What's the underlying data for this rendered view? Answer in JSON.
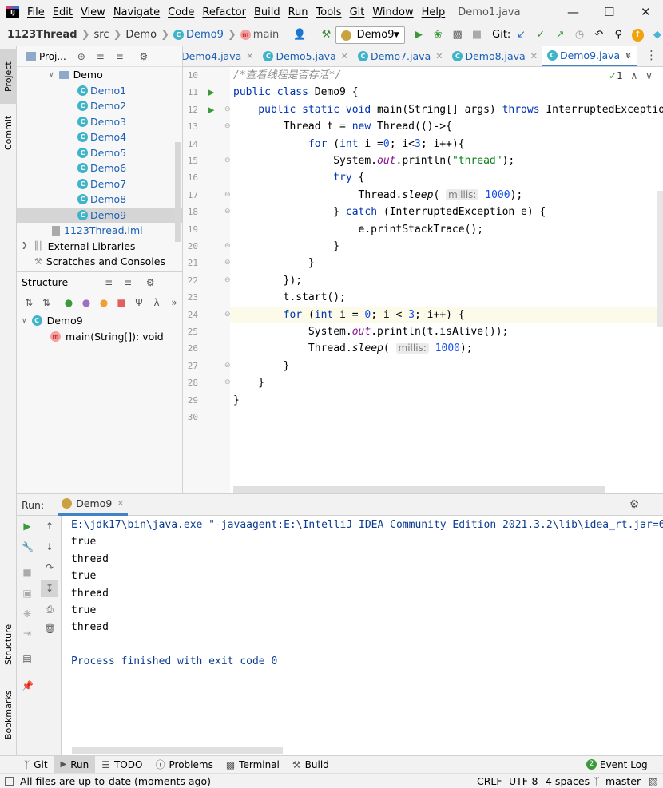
{
  "menubar": {
    "items": [
      "File",
      "Edit",
      "View",
      "Navigate",
      "Code",
      "Refactor",
      "Build",
      "Run",
      "Tools",
      "Git",
      "Window",
      "Help"
    ],
    "window_title": "Demo1.java"
  },
  "navbar": {
    "breadcrumbs": [
      "1123Thread",
      "src",
      "Demo",
      "Demo9",
      "main"
    ],
    "run_config": "Demo9",
    "git_label": "Git:"
  },
  "left_stripe": {
    "project": "Project",
    "commit": "Commit",
    "structure": "Structure",
    "bookmarks": "Bookmarks"
  },
  "project_panel": {
    "title": "Proj...",
    "tree": [
      {
        "label": "Demo",
        "type": "folder",
        "indent": 1
      },
      {
        "label": "Demo1",
        "type": "class",
        "indent": 2
      },
      {
        "label": "Demo2",
        "type": "class",
        "indent": 2
      },
      {
        "label": "Demo3",
        "type": "class",
        "indent": 2
      },
      {
        "label": "Demo4",
        "type": "class",
        "indent": 2
      },
      {
        "label": "Demo5",
        "type": "class",
        "indent": 2
      },
      {
        "label": "Demo6",
        "type": "class",
        "indent": 2
      },
      {
        "label": "Demo7",
        "type": "class",
        "indent": 2
      },
      {
        "label": "Demo8",
        "type": "class",
        "indent": 2
      },
      {
        "label": "Demo9",
        "type": "class",
        "indent": 2,
        "selected": true
      },
      {
        "label": "1123Thread.iml",
        "type": "iml",
        "indent": 1
      },
      {
        "label": "External Libraries",
        "type": "lib",
        "indent": 0
      },
      {
        "label": "Scratches and Consoles",
        "type": "scratch",
        "indent": 0
      }
    ]
  },
  "structure_panel": {
    "title": "Structure",
    "class_name": "Demo9",
    "member": "main(String[]): void"
  },
  "editor": {
    "tabs": [
      {
        "label": "Demo4.java",
        "active": false
      },
      {
        "label": "Demo5.java",
        "active": false
      },
      {
        "label": "Demo7.java",
        "active": false
      },
      {
        "label": "Demo8.java",
        "active": false
      },
      {
        "label": "Demo9.java",
        "active": true
      }
    ],
    "inspection_count": "1",
    "line_numbers": [
      "10",
      "11",
      "12",
      "13",
      "14",
      "15",
      "16",
      "17",
      "18",
      "19",
      "20",
      "21",
      "22",
      "23",
      "24",
      "25",
      "26",
      "27",
      "28",
      "29",
      "30"
    ],
    "lines": [
      [
        {
          "t": "/*查看线程是否存活*/",
          "c": "cm"
        }
      ],
      [
        {
          "t": "public class ",
          "c": "kw"
        },
        {
          "t": "Demo9 {",
          "c": ""
        }
      ],
      [
        {
          "t": "    public static void ",
          "c": "kw"
        },
        {
          "t": "main",
          "c": ""
        },
        {
          "t": "(String[] args) ",
          "c": ""
        },
        {
          "t": "throws ",
          "c": "kw"
        },
        {
          "t": "InterruptedException {",
          "c": ""
        }
      ],
      [
        {
          "t": "        Thread t = ",
          "c": ""
        },
        {
          "t": "new ",
          "c": "kw"
        },
        {
          "t": "Thread(()->{",
          "c": ""
        }
      ],
      [
        {
          "t": "            ",
          "c": ""
        },
        {
          "t": "for ",
          "c": "kw"
        },
        {
          "t": "(",
          "c": ""
        },
        {
          "t": "int ",
          "c": "kw"
        },
        {
          "t": "i =",
          "c": ""
        },
        {
          "t": "0",
          "c": "num"
        },
        {
          "t": "; i<",
          "c": ""
        },
        {
          "t": "3",
          "c": "num"
        },
        {
          "t": "; i++){",
          "c": ""
        }
      ],
      [
        {
          "t": "                System.",
          "c": ""
        },
        {
          "t": "out",
          "c": "it"
        },
        {
          "t": ".println(",
          "c": ""
        },
        {
          "t": "\"thread\"",
          "c": "str"
        },
        {
          "t": ");",
          "c": ""
        }
      ],
      [
        {
          "t": "                ",
          "c": ""
        },
        {
          "t": "try ",
          "c": "kw"
        },
        {
          "t": "{",
          "c": ""
        }
      ],
      [
        {
          "t": "                    Thread.",
          "c": ""
        },
        {
          "t": "sleep",
          "c": "it2"
        },
        {
          "t": "( ",
          "c": ""
        },
        {
          "t": "millis:",
          "c": "hint"
        },
        {
          "t": " ",
          "c": ""
        },
        {
          "t": "1000",
          "c": "num"
        },
        {
          "t": ");",
          "c": ""
        }
      ],
      [
        {
          "t": "                } ",
          "c": ""
        },
        {
          "t": "catch ",
          "c": "kw"
        },
        {
          "t": "(InterruptedException e) {",
          "c": ""
        }
      ],
      [
        {
          "t": "                    e.printStackTrace();",
          "c": ""
        }
      ],
      [
        {
          "t": "                }",
          "c": ""
        }
      ],
      [
        {
          "t": "            }",
          "c": ""
        }
      ],
      [
        {
          "t": "        });",
          "c": ""
        }
      ],
      [
        {
          "t": "        t.start();",
          "c": ""
        }
      ],
      [
        {
          "t": "        ",
          "c": ""
        },
        {
          "t": "for ",
          "c": "kw"
        },
        {
          "t": "(",
          "c": ""
        },
        {
          "t": "int ",
          "c": "kw"
        },
        {
          "t": "i = ",
          "c": ""
        },
        {
          "t": "0",
          "c": "num"
        },
        {
          "t": "; i < ",
          "c": ""
        },
        {
          "t": "3",
          "c": "num"
        },
        {
          "t": "; i++) {",
          "c": ""
        }
      ],
      [
        {
          "t": "            System.",
          "c": ""
        },
        {
          "t": "out",
          "c": "it"
        },
        {
          "t": ".println(t.isAlive());",
          "c": ""
        }
      ],
      [
        {
          "t": "            Thread.",
          "c": ""
        },
        {
          "t": "sleep",
          "c": "it2"
        },
        {
          "t": "( ",
          "c": ""
        },
        {
          "t": "millis:",
          "c": "hint"
        },
        {
          "t": " ",
          "c": ""
        },
        {
          "t": "1000",
          "c": "num"
        },
        {
          "t": ");",
          "c": ""
        }
      ],
      [
        {
          "t": "        }",
          "c": ""
        }
      ],
      [
        {
          "t": "    }",
          "c": ""
        }
      ],
      [
        {
          "t": "}",
          "c": ""
        }
      ],
      [
        {
          "t": "",
          "c": ""
        }
      ]
    ]
  },
  "run_panel": {
    "label": "Run:",
    "tab": "Demo9",
    "output": [
      {
        "text": "E:\\jdk17\\bin\\java.exe \"-javaagent:E:\\IntelliJ IDEA Community Edition 2021.3.2\\lib\\idea_rt.jar=6",
        "color": "#0c3d91"
      },
      {
        "text": "true",
        "color": "#000000"
      },
      {
        "text": "thread",
        "color": "#000000"
      },
      {
        "text": "true",
        "color": "#000000"
      },
      {
        "text": "thread",
        "color": "#000000"
      },
      {
        "text": "true",
        "color": "#000000"
      },
      {
        "text": "thread",
        "color": "#000000"
      },
      {
        "text": "",
        "color": "#000000"
      },
      {
        "text": "Process finished with exit code 0",
        "color": "#0c3d91"
      }
    ]
  },
  "bottom_tabs": [
    "Git",
    "Run",
    "TODO",
    "Problems",
    "Terminal",
    "Build"
  ],
  "event_log": {
    "label": "Event Log",
    "count": "2"
  },
  "statusbar": {
    "message": "All files are up-to-date (moments ago)",
    "line_sep": "CRLF",
    "encoding": "UTF-8",
    "indent": "4 spaces",
    "branch": "master"
  }
}
